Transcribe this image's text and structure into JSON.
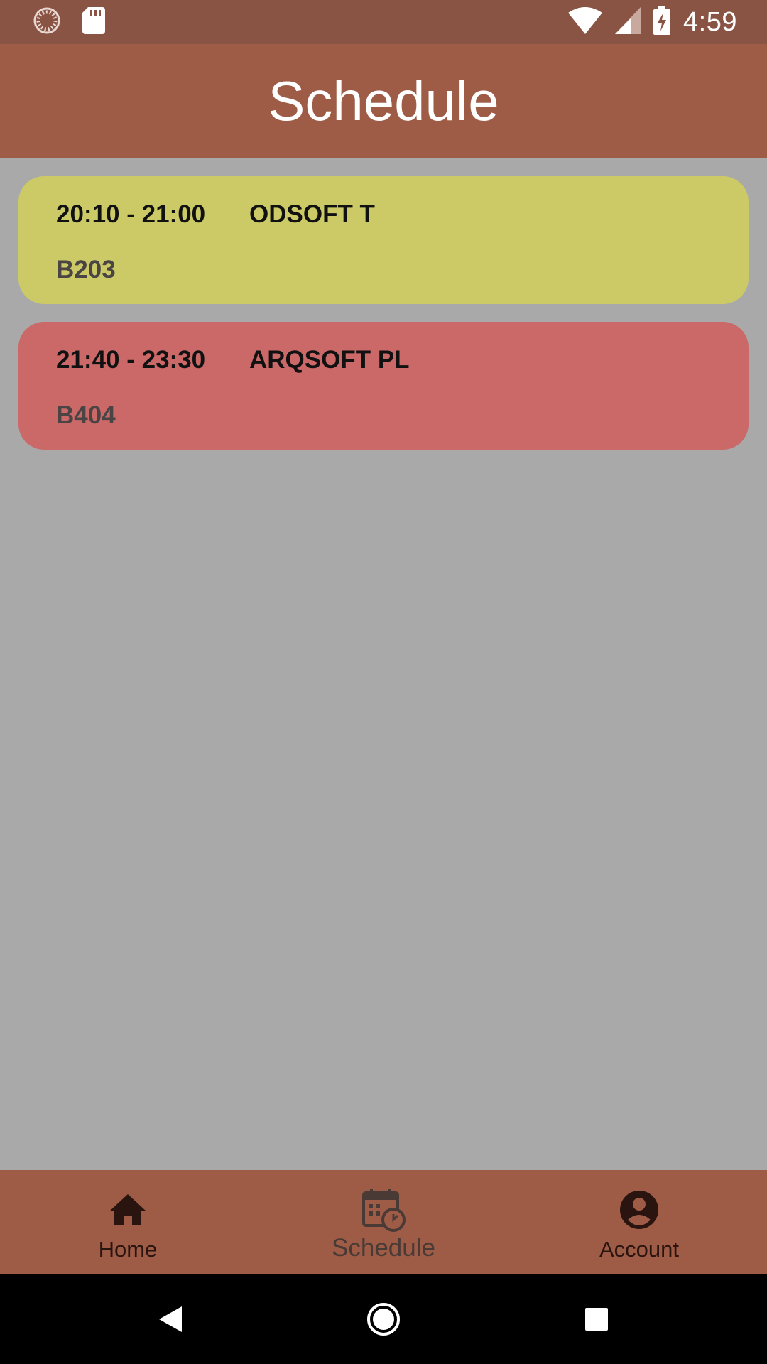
{
  "status_bar": {
    "time": "4:59",
    "icons": [
      "loading-spinner-icon",
      "sd-card-icon",
      "wifi-icon",
      "signal-icon",
      "battery-charging-icon"
    ]
  },
  "app_bar": {
    "title": "Schedule"
  },
  "schedule": [
    {
      "time": "20:10 - 21:00",
      "name": "ODSOFT T",
      "room": "B203",
      "color": "#cbca67"
    },
    {
      "time": "21:40 - 23:30",
      "name": "ARQSOFT PL",
      "room": "B404",
      "color": "#cb6868"
    }
  ],
  "bottom_nav": {
    "items": [
      {
        "label": "Home",
        "icon": "home-icon",
        "active": false
      },
      {
        "label": "Schedule",
        "icon": "calendar-clock-icon",
        "active": true
      },
      {
        "label": "Account",
        "icon": "account-circle-icon",
        "active": false
      }
    ]
  },
  "system_nav": {
    "icons": [
      "back-icon",
      "home-circle-icon",
      "recents-icon"
    ]
  },
  "colors": {
    "status_bar": "#8a5444",
    "app_bar": "#9e5c46",
    "background": "#a9a9a9"
  }
}
